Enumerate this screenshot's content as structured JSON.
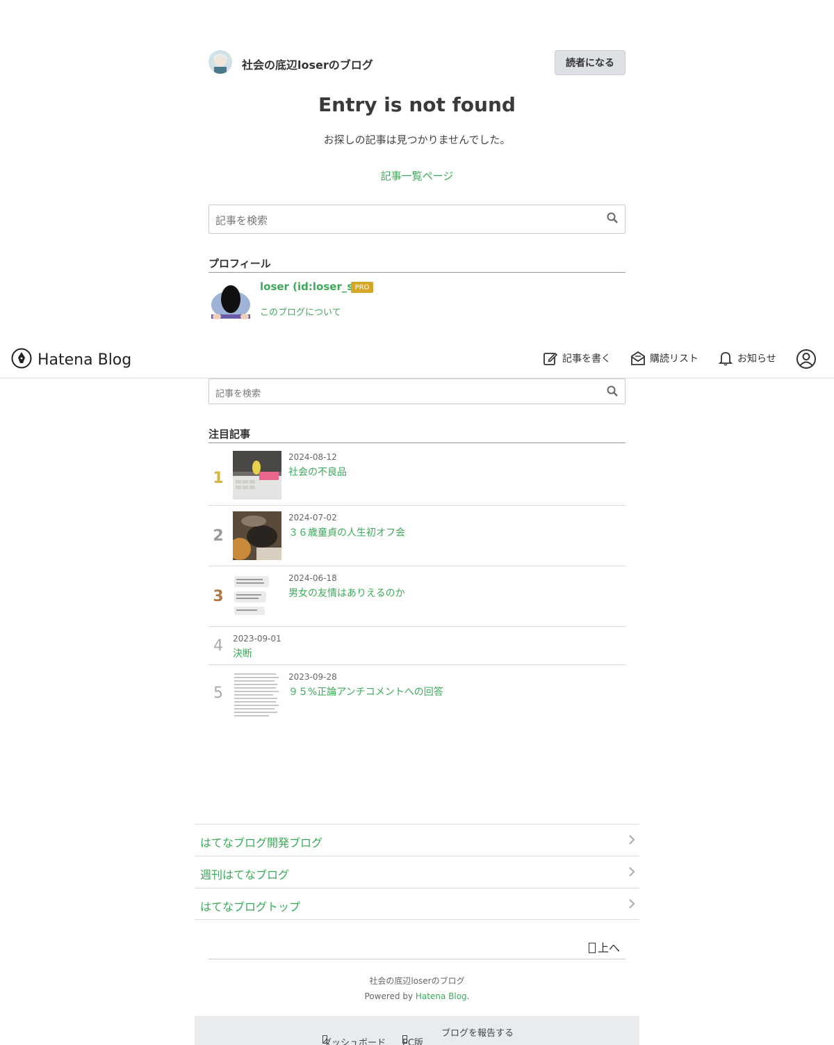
{
  "blog": {
    "title": "社会の底辺loserのブログ",
    "subscribe_label": "読者になる"
  },
  "not_found": {
    "title": "Entry is not found",
    "message": "お探しの記事は見つかりませんでした。",
    "archive_link": "記事一覧ページ"
  },
  "search": {
    "placeholder": "記事を検索"
  },
  "profile": {
    "section_title": "プロフィール",
    "name": "loser (id:loser_s)",
    "badge": "PRO",
    "about_link": "このブログについて"
  },
  "global_bar": {
    "logo_text": "Hatena Blog",
    "write_label": "記事を書く",
    "reading_list_label": "購読リスト",
    "notifications_label": "お知らせ"
  },
  "featured": {
    "section_title": "注目記事",
    "items": [
      {
        "rank": "1",
        "date": "2024-08-12",
        "title": "社会の不良品",
        "rank_color": "#d4b43a"
      },
      {
        "rank": "2",
        "date": "2024-07-02",
        "title": "３６歳童貞の人生初オフ会",
        "rank_color": "#9a9a9a"
      },
      {
        "rank": "3",
        "date": "2024-06-18",
        "title": "男女の友情はありえるのか",
        "rank_color": "#b07a4a"
      },
      {
        "rank": "4",
        "date": "2023-09-01",
        "title": "決断",
        "rank_color": "#aaaaaa"
      },
      {
        "rank": "5",
        "date": "2023-09-28",
        "title": "９５%正論アンチコメントへの回答",
        "rank_color": "#aaaaaa"
      }
    ]
  },
  "footer_links": [
    {
      "label": "はてなブログ開発ブログ"
    },
    {
      "label": "週刊はてなブログ"
    },
    {
      "label": "はてなブログトップ"
    }
  ],
  "footer": {
    "pagetop_label": "上へ",
    "blog_name": "社会の底辺loserのブログ",
    "powered_prefix": "Powered by ",
    "powered_link": "Hatena Blog",
    "powered_suffix": ".",
    "dashboard_label": "ダッシュボード",
    "pc_label": "PC版",
    "report_label": "ブログを報告する"
  }
}
